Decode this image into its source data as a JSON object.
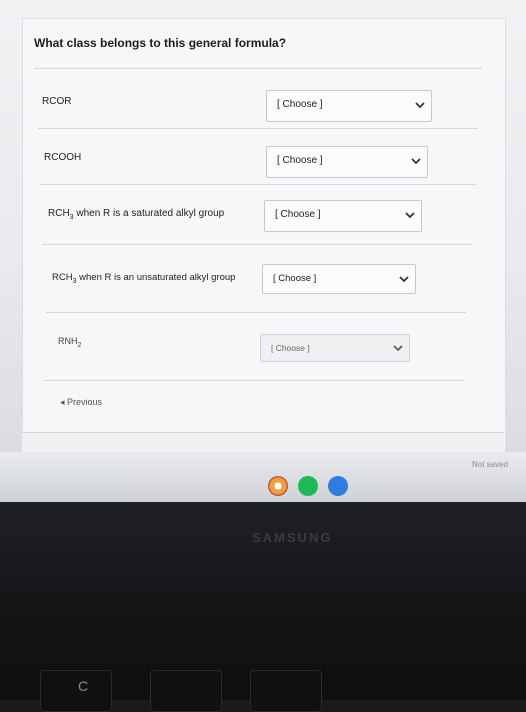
{
  "quiz": {
    "question": "What class belongs to this general formula?",
    "rows": [
      {
        "formula": "RCOR",
        "selected": "[ Choose ]"
      },
      {
        "formula": "RCOOH",
        "selected": "[ Choose ]"
      },
      {
        "formula_prefix": "RCH",
        "formula_sub": "3",
        "formula_suffix": " when R is a saturated alkyl group",
        "selected": "[ Choose ]"
      },
      {
        "formula_prefix": "RCH",
        "formula_sub": "3",
        "formula_suffix": " when R is an unsaturated alkyl group",
        "selected": "[ Choose ]"
      },
      {
        "formula_prefix": "RNH",
        "formula_sub": "2",
        "formula_suffix": "",
        "selected": "[ Choose ]"
      }
    ],
    "previous_label": "Previous",
    "status": "Not saved"
  },
  "device": {
    "brand": "SAMSUNG",
    "key_glyph": "C"
  },
  "colors": {
    "chrome_icon": "#e8a33d",
    "spotify_icon": "#1db954",
    "files_icon": "#2f7de1"
  },
  "icons": [
    "chevron-down-icon",
    "chrome-icon",
    "spotify-icon",
    "files-icon",
    "previous-icon"
  ]
}
